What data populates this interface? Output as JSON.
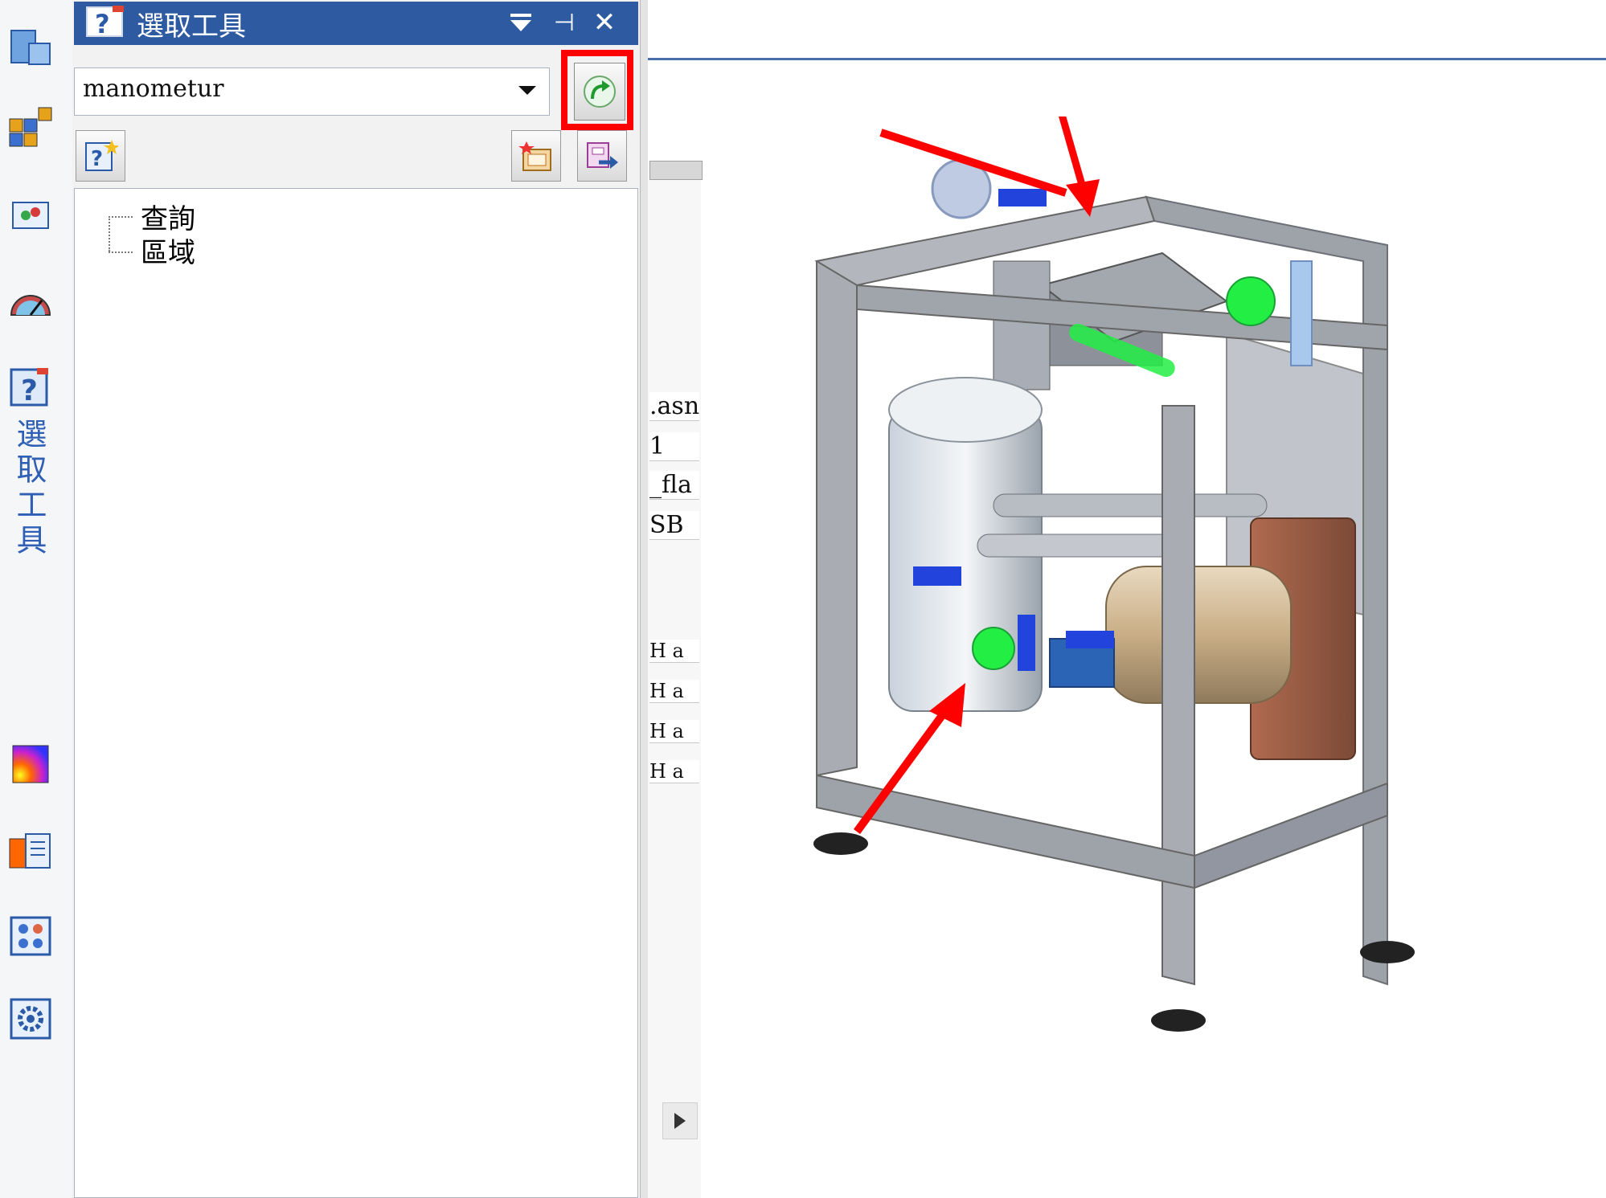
{
  "panel": {
    "title": "選取工具",
    "pin_symbol": "⊣",
    "close_symbol": "✕",
    "query_value": "manometur"
  },
  "sidebar": {
    "vertical_tab_label": "選取工具"
  },
  "tree": {
    "items": [
      "查詢",
      "區域"
    ]
  },
  "view": {
    "fragments": [
      ".asn",
      "1",
      "_fla",
      "SB",
      "H a",
      "H a",
      "H a",
      "H a"
    ]
  },
  "colors": {
    "title_bar": "#2d5aa0",
    "highlight": "#ff0000",
    "selected": "#22ee44",
    "frame": "#a9acb3",
    "accent_blue": "#2244dd"
  }
}
